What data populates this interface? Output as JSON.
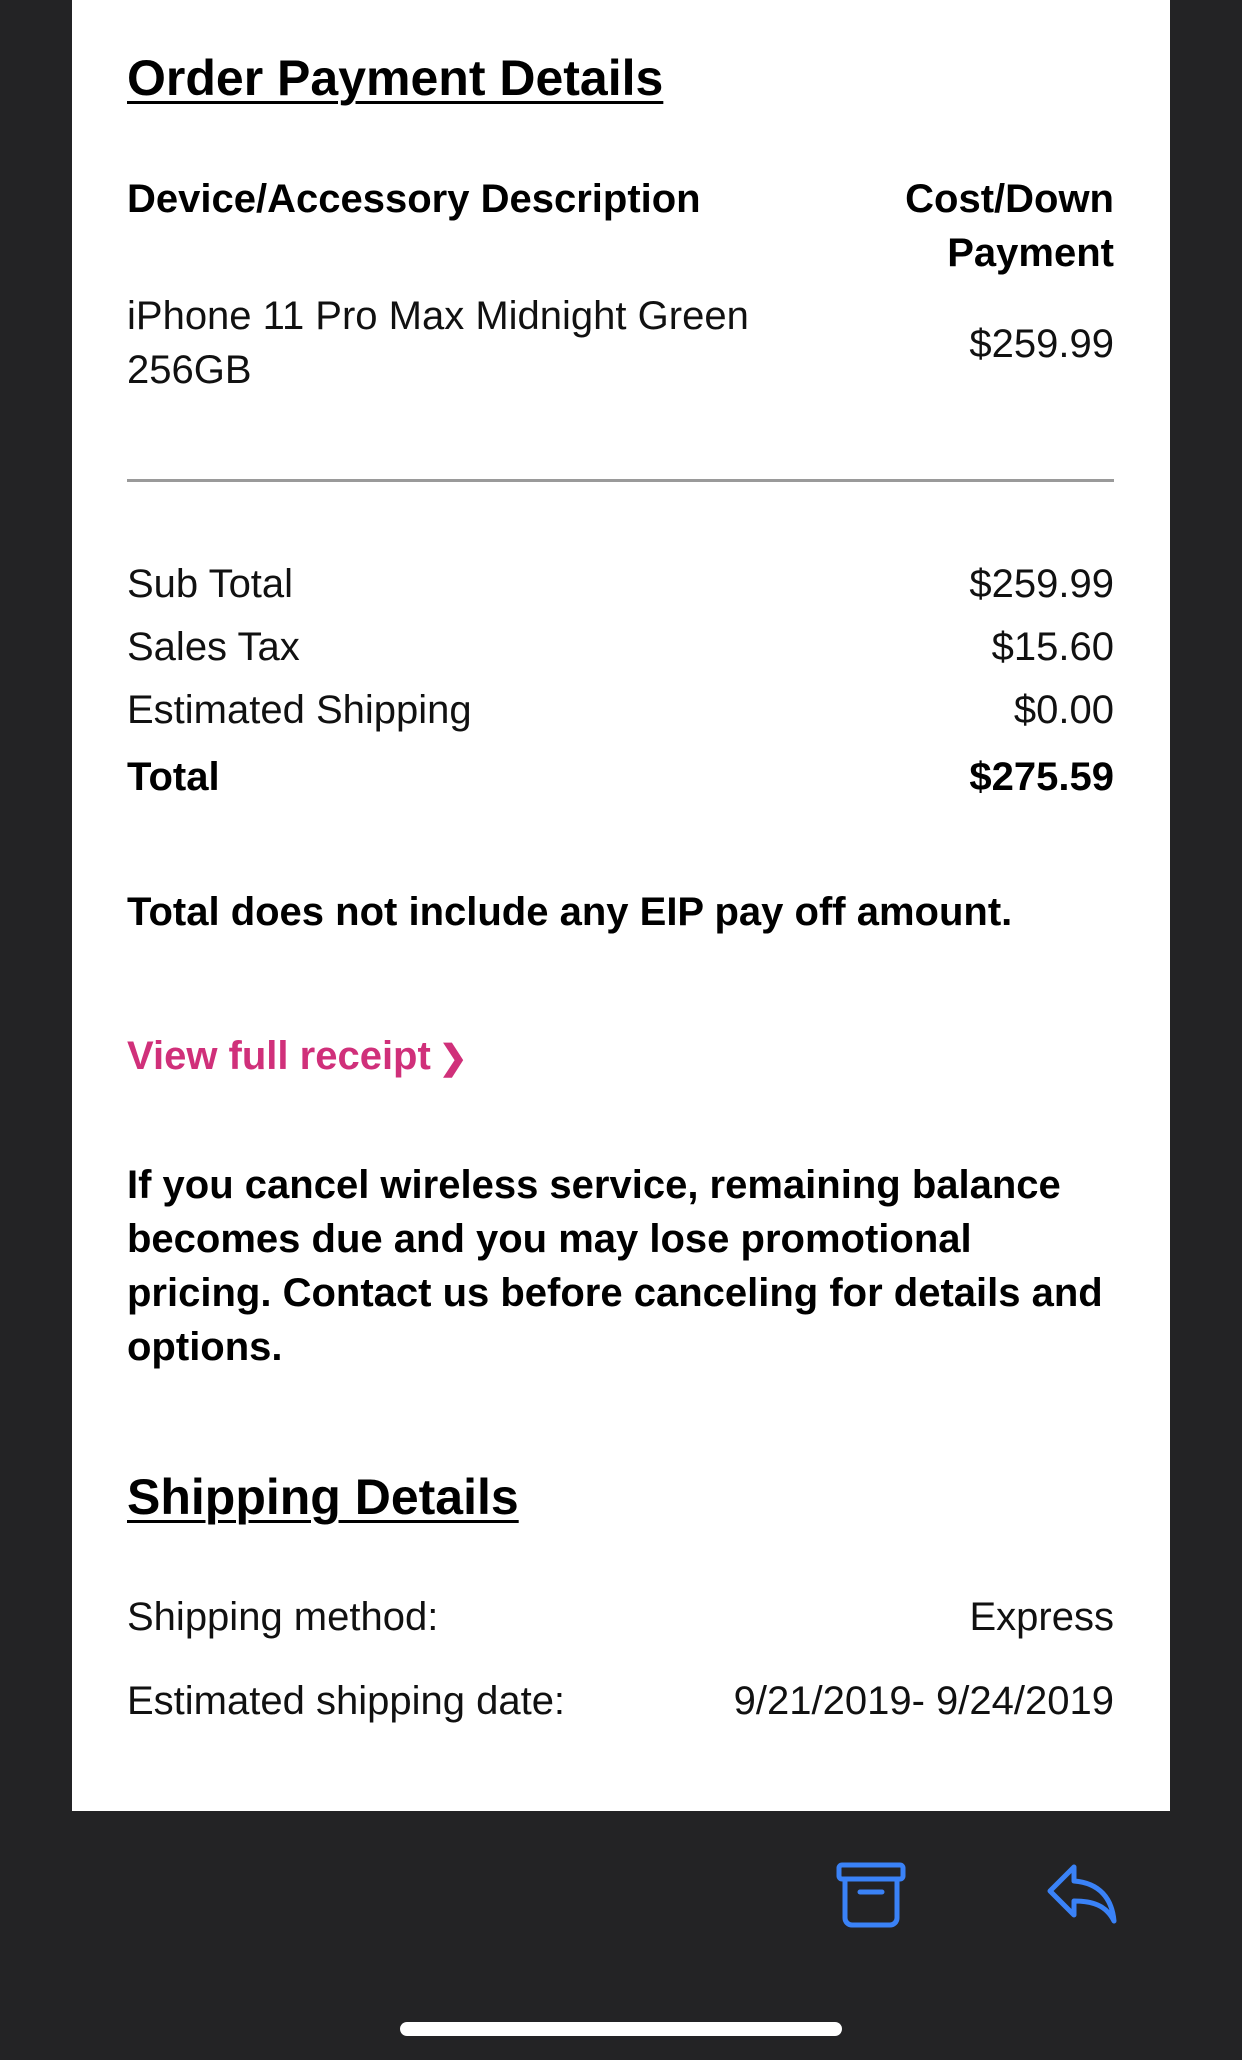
{
  "order_payment": {
    "heading": "Order Payment Details",
    "col_left": "Device/Accessory Description",
    "col_right": "Cost/Down Payment",
    "item": {
      "description": "iPhone 11 Pro Max Midnight Green 256GB",
      "price": "$259.99"
    },
    "summary": [
      {
        "label": "Sub Total",
        "value": "$259.99"
      },
      {
        "label": "Sales Tax",
        "value": "$15.60"
      },
      {
        "label": "Estimated Shipping",
        "value": "$0.00"
      },
      {
        "label": "Total",
        "value": "$275.59"
      }
    ],
    "eip_notice": "Total does not include any EIP pay off amount.",
    "receipt_link": "View full receipt",
    "receipt_link_chevron": "❯",
    "cancel_notice": "If you cancel wireless service, remaining balance becomes due and you may lose promotional pricing. Contact us before canceling for details and options."
  },
  "shipping": {
    "heading": "Shipping Details",
    "method_label": "Shipping method:",
    "method_value": "Express",
    "date_label": "Estimated shipping date:",
    "date_value": "9/21/2019- 9/24/2019"
  },
  "toolbar": {
    "archive_icon": "archive-icon",
    "reply_icon": "reply-icon",
    "icon_color": "#3a82f7"
  },
  "colors": {
    "link": "#d0307a",
    "background": "#232325",
    "card": "#ffffff"
  }
}
